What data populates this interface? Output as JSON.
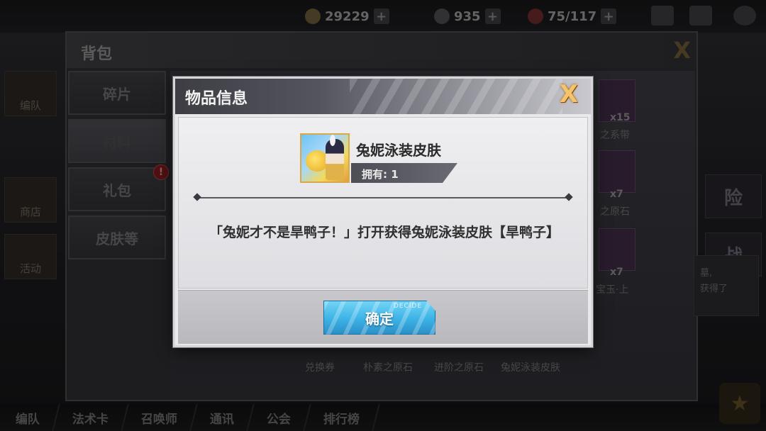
{
  "topbar": {
    "gold": "29229",
    "gems": "935",
    "stamina": "75/117",
    "plus": "+"
  },
  "leftnav": [
    "编队",
    "商店",
    "活动"
  ],
  "rightnav": [
    "险",
    "战"
  ],
  "bottombar": [
    "编队",
    "法术卡",
    "召唤师",
    "通讯",
    "公会",
    "排行榜"
  ],
  "backpack": {
    "title": "背包",
    "close": "X",
    "tabs": [
      {
        "label": "碎片"
      },
      {
        "label": "材料"
      },
      {
        "label": "礼包",
        "badge": "!"
      },
      {
        "label": "皮肤等"
      }
    ],
    "items_right": [
      {
        "count": "x15",
        "label": "之系带"
      },
      {
        "count": "x7",
        "label": "之原石"
      },
      {
        "count": "x7",
        "label": "宝玉·上"
      }
    ],
    "items_bottom": [
      "兑换券",
      "朴素之原石",
      "进阶之原石",
      "兔妮泳装皮肤"
    ],
    "side_note": [
      "墓,",
      "获得了"
    ]
  },
  "modal": {
    "title": "物品信息",
    "close": "X",
    "item_name": "兔妮泳装皮肤",
    "owned": "拥有: 1",
    "description": "「兔妮才不是旱鸭子！」打开获得兔妮泳装皮肤【旱鸭子】",
    "confirm": "确定",
    "confirm_tag": "DECIDE"
  },
  "colors": {
    "confirm_button": "#3cb2e6",
    "close_gold": "#f4c46a",
    "badge_red": "#7a1b1b"
  }
}
